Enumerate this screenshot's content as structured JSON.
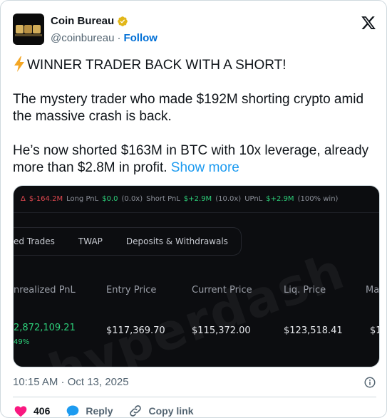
{
  "author": {
    "name": "Coin Bureau",
    "handle": "@coinbureau",
    "separator": "·",
    "follow_label": "Follow"
  },
  "tweet": {
    "line1": "WINNER TRADER BACK WITH A SHORT!",
    "para2": "The mystery trader who made $192M shorting crypto amid the massive crash is back.",
    "para3": "He’s now shorted $163M in BTC with 10x leverage, already more than $2.8M in profit.",
    "show_more": "Show more"
  },
  "media": {
    "stats": {
      "delta_label": "Δ",
      "delta_value": "$-164.2M",
      "long_label": "Long PnL",
      "long_value": "$0.0",
      "long_note": "(0.0x)",
      "short_label": "Short PnL",
      "short_value": "$+2.9M",
      "short_note": "(10.0x)",
      "upnl_label": "UPnL",
      "upnl_value": "$+2.9M",
      "upnl_note": "(100% win)"
    },
    "tabs": [
      "ed Trades",
      "TWAP",
      "Deposits & Withdrawals"
    ],
    "headers": [
      "nrealized PnL",
      "Entry Price",
      "Current Price",
      "Liq. Price",
      "Ma"
    ],
    "row": [
      "2,872,109.21",
      "$117,369.70",
      "$115,372.00",
      "$123,518.41",
      "$1"
    ],
    "row_sub": "49%",
    "watermark": "hyperdash"
  },
  "timestamp": "10:15 AM · Oct 13, 2025",
  "actions": {
    "likes": "406",
    "reply_label": "Reply",
    "copy_label": "Copy link"
  },
  "colors": {
    "accent": "#1d9bf0",
    "follow": "#006fd6",
    "like": "#f91880",
    "negative": "#e0484f",
    "positive": "#2dd07a"
  }
}
